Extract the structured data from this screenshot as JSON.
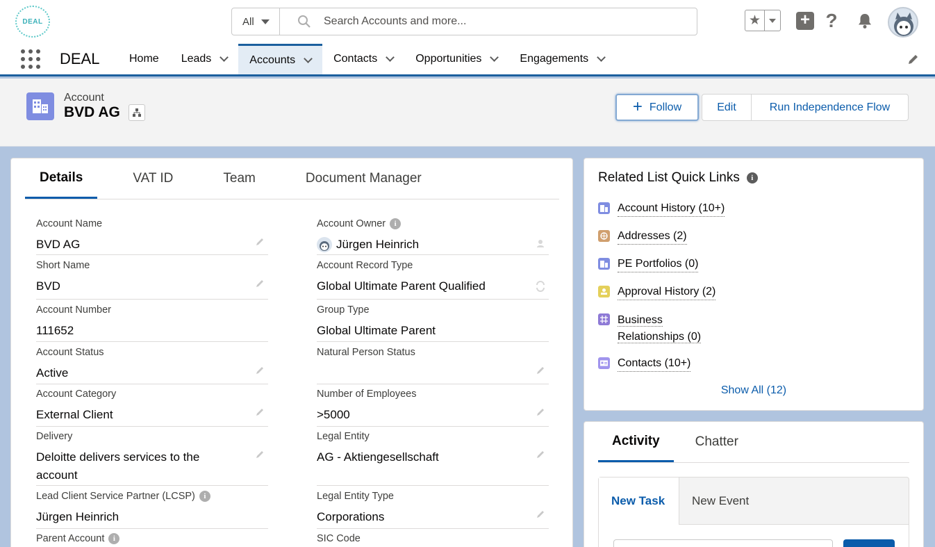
{
  "header": {
    "logo_text": "DEAL",
    "search_scope": "All",
    "search_placeholder": "Search Accounts and more..."
  },
  "nav": {
    "app_name": "DEAL",
    "items": [
      {
        "label": "Home",
        "dropdown": false,
        "active": false
      },
      {
        "label": "Leads",
        "dropdown": true,
        "active": false
      },
      {
        "label": "Accounts",
        "dropdown": true,
        "active": true
      },
      {
        "label": "Contacts",
        "dropdown": true,
        "active": false
      },
      {
        "label": "Opportunities",
        "dropdown": true,
        "active": false
      },
      {
        "label": "Engagements",
        "dropdown": true,
        "active": false
      }
    ]
  },
  "record": {
    "entity": "Account",
    "title": "BVD AG",
    "buttons": {
      "follow": "Follow",
      "edit": "Edit",
      "flow": "Run Independence Flow"
    }
  },
  "detail_tabs": [
    "Details",
    "VAT ID",
    "Team",
    "Document Manager"
  ],
  "fields_left": [
    {
      "label": "Account Name",
      "value": "BVD AG"
    },
    {
      "label": "Short Name",
      "value": "BVD"
    },
    {
      "label": "Account Number",
      "value": "111652"
    },
    {
      "label": "Account Status",
      "value": "Active"
    },
    {
      "label": "Account Category",
      "value": "External Client"
    },
    {
      "label": "Delivery",
      "value": "Deloitte delivers services to the account"
    },
    {
      "label": "Lead Client Service Partner (LCSP)",
      "value": "Jürgen Heinrich"
    },
    {
      "label": "Parent Account",
      "value": ""
    }
  ],
  "fields_right": [
    {
      "label": "Account Owner",
      "value": "Jürgen Heinrich"
    },
    {
      "label": "Account Record Type",
      "value": "Global Ultimate Parent Qualified"
    },
    {
      "label": "Group Type",
      "value": "Global Ultimate Parent"
    },
    {
      "label": "Natural Person Status",
      "value": ""
    },
    {
      "label": "Number of Employees",
      "value": ">5000"
    },
    {
      "label": "Legal Entity",
      "value": "AG - Aktiengesellschaft"
    },
    {
      "label": "Legal Entity Type",
      "value": "Corporations"
    },
    {
      "label": "SIC Code",
      "value": ""
    }
  ],
  "related_lists": {
    "title": "Related List Quick Links",
    "items": [
      {
        "label": "Account History (10+)",
        "icon": "account-history-icon",
        "color": "#7f8de1"
      },
      {
        "label": "Addresses (2)",
        "icon": "address-icon",
        "color": "#d09f6e"
      },
      {
        "label": "PE Portfolios (0)",
        "icon": "portfolio-icon",
        "color": "#7f8de1"
      },
      {
        "label": "Approval History (2)",
        "icon": "approval-icon",
        "color": "#e4d05b"
      },
      {
        "label_line1": "Business",
        "label_line2": "Relationships (0)",
        "icon": "relationship-icon",
        "color": "#8e7ad6"
      },
      {
        "label": "Contacts (10+)",
        "icon": "contact-icon",
        "color": "#a094ed"
      }
    ],
    "show_all": "Show All (12)"
  },
  "activity": {
    "tabs": [
      "Activity",
      "Chatter"
    ],
    "publisher_tabs": [
      "New Task",
      "New Event"
    ]
  }
}
